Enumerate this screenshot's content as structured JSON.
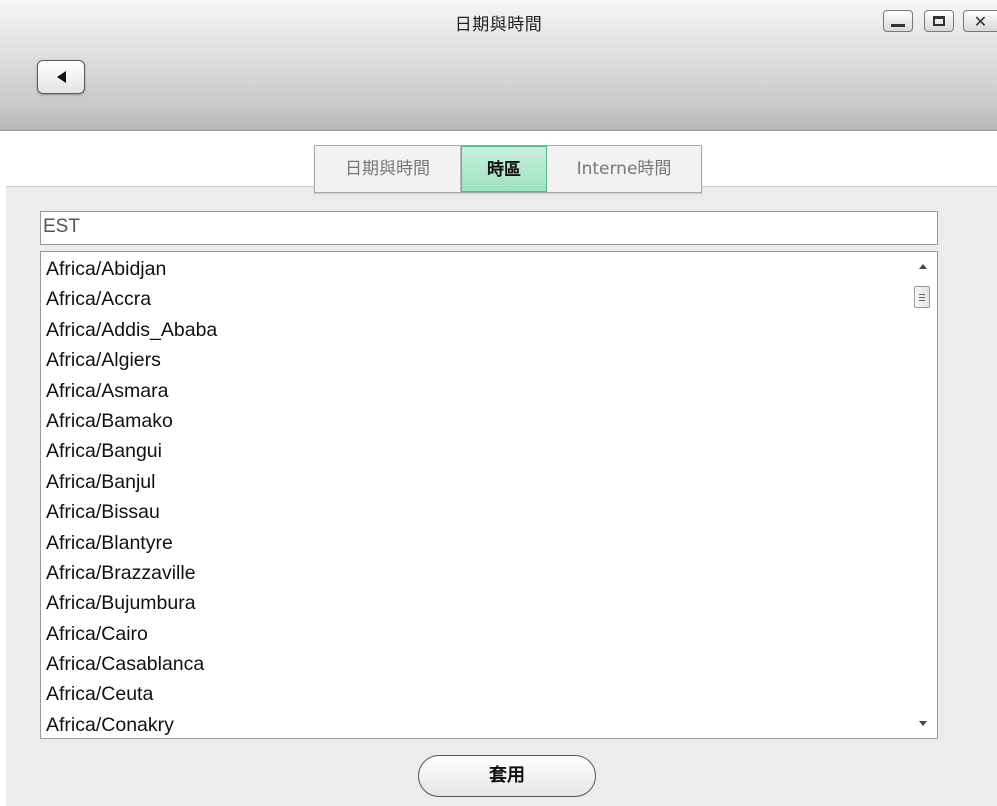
{
  "window": {
    "title": "日期與時間"
  },
  "controls": {
    "minimize_icon": "minimize-icon",
    "maximize_icon": "maximize-icon",
    "close_icon": "close-icon",
    "back_icon": "back-arrow-icon"
  },
  "tabs": [
    {
      "label": "日期與時間",
      "active": false
    },
    {
      "label": "時區",
      "active": true
    },
    {
      "label": "Interne時間",
      "active": false
    }
  ],
  "search": {
    "value": "EST"
  },
  "timezones": [
    "Africa/Abidjan",
    "Africa/Accra",
    "Africa/Addis_Ababa",
    "Africa/Algiers",
    "Africa/Asmara",
    "Africa/Bamako",
    "Africa/Bangui",
    "Africa/Banjul",
    "Africa/Bissau",
    "Africa/Blantyre",
    "Africa/Brazzaville",
    "Africa/Bujumbura",
    "Africa/Cairo",
    "Africa/Casablanca",
    "Africa/Ceuta",
    "Africa/Conakry"
  ],
  "apply_button": {
    "label": "套用"
  },
  "colors": {
    "active_tab": "#9ee2c2",
    "active_tab_border": "#4fba8a"
  }
}
